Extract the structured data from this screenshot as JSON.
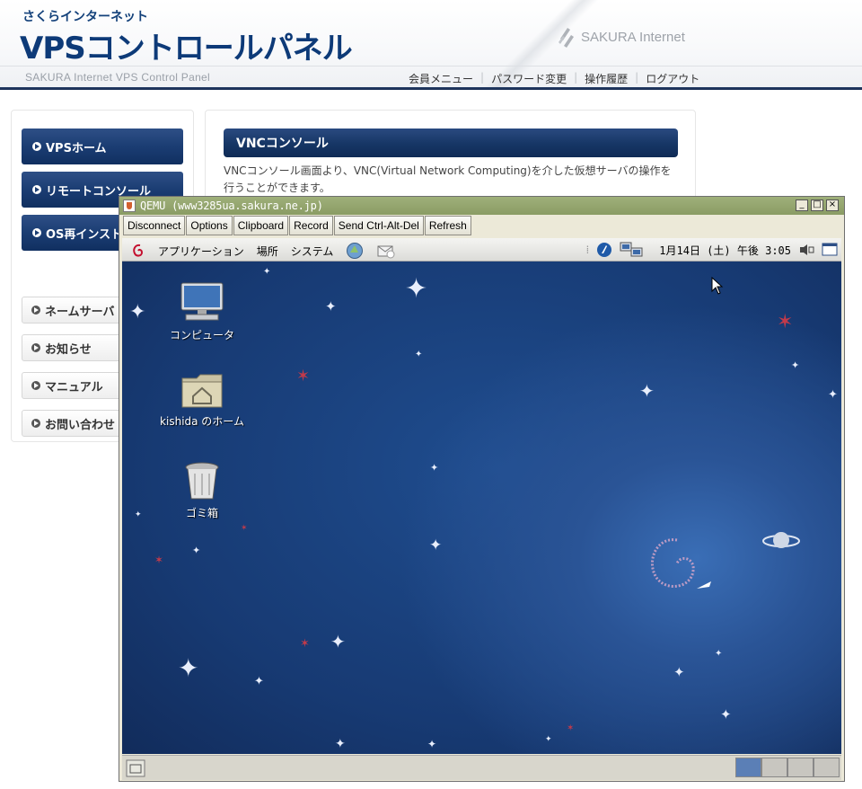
{
  "header": {
    "brand_sub": "さくらインターネット",
    "brand_title": "VPSコントロールパネル",
    "logo_text": "SAKURA Internet",
    "tagline": "SAKURA Internet VPS Control Panel",
    "nav": [
      "会員メニュー",
      "パスワード変更",
      "操作履歴",
      "ログアウト"
    ]
  },
  "sidebar": {
    "primary": [
      "VPSホーム",
      "リモートコンソール",
      "OS再インストール"
    ],
    "secondary": [
      "ネームサーバ",
      "お知らせ",
      "マニュアル",
      "お問い合わせ"
    ]
  },
  "content": {
    "section_title": "VNCコンソール",
    "description": "VNCコンソール画面より、VNC(Virtual Network Computing)を介した仮想サーバの操作を行うことができます。"
  },
  "qemu": {
    "title": "QEMU (www3285ua.sakura.ne.jp)",
    "toolbar": [
      "Disconnect",
      "Options",
      "Clipboard",
      "Record",
      "Send Ctrl-Alt-Del",
      "Refresh"
    ],
    "panel_menus": [
      "アプリケーション",
      "場所",
      "システム"
    ],
    "clock": "1月14日 (土) 午後 3:05",
    "desktop_icons": {
      "computer": "コンピュータ",
      "home": "kishida のホーム",
      "trash": "ゴミ箱"
    },
    "workspaces": 4,
    "active_workspace": 1
  },
  "colors": {
    "brand_navy": "#0d3a78",
    "nav_button": "#1b3d73",
    "qemu_title": "#8a9c64",
    "desktop_blue": "#1f4d8f"
  }
}
